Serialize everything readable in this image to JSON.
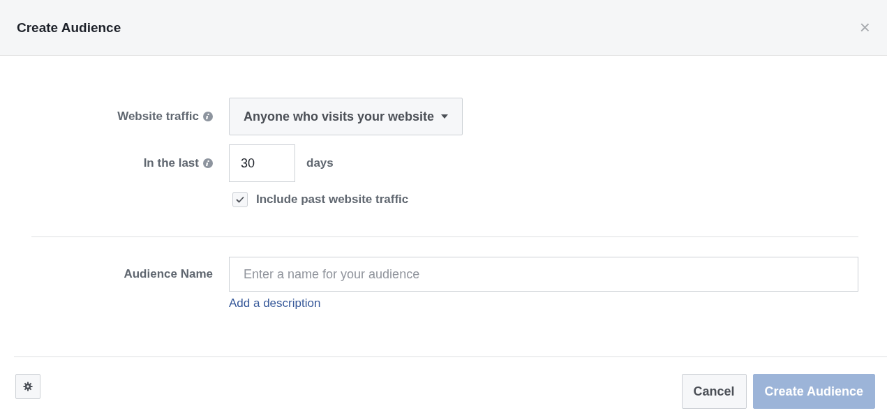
{
  "dialog": {
    "title": "Create Audience",
    "close": "×"
  },
  "website_traffic": {
    "label": "Website traffic",
    "value": "Anyone who visits your website"
  },
  "in_the_last": {
    "label": "In the last",
    "value": "30",
    "unit": "days"
  },
  "include_past": {
    "label": "Include past website traffic",
    "checked": true
  },
  "audience_name": {
    "label": "Audience Name",
    "placeholder": "Enter a name for your audience",
    "link": "Add a description"
  },
  "footer": {
    "buttons": [
      {
        "label": "Cancel",
        "kind": "secondary",
        "disabled": false
      },
      {
        "label": "Create Audience",
        "kind": "primary",
        "disabled": true
      }
    ]
  }
}
